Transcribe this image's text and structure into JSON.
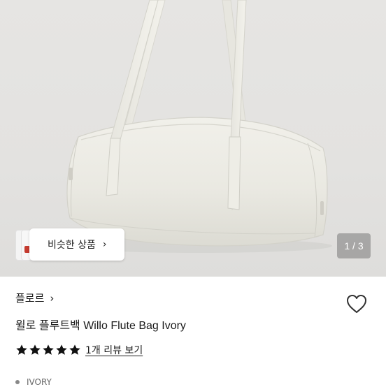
{
  "gallery": {
    "similar_label": "비슷한 상품",
    "counter": "1 / 3"
  },
  "product": {
    "brand": "플로르",
    "title": "윌로 플루트백 Willo Flute Bag Ivory",
    "rating": 5,
    "review_link": "1개 리뷰 보기",
    "option_peek": "IVORY"
  },
  "colors": {
    "background": "#e4e3e1",
    "bag": "#ecebe4",
    "star": "#111111"
  },
  "icons": {
    "heart": "heart-outline-icon",
    "chevron": "chevron-right-icon",
    "star": "star-filled-icon"
  }
}
